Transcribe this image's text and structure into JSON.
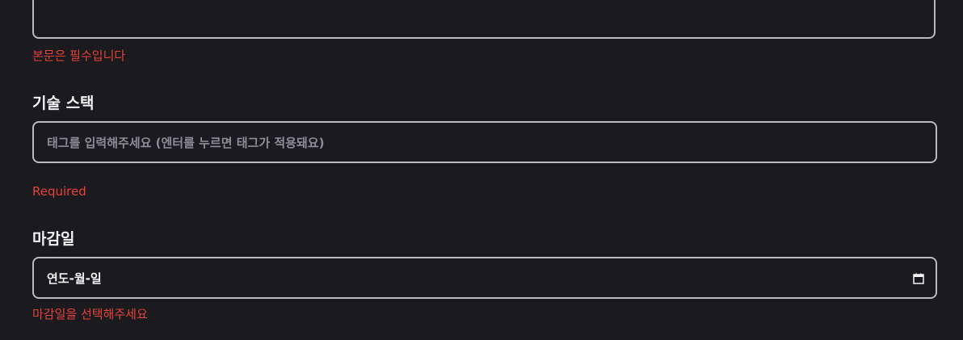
{
  "body_field": {
    "error": "본문은 필수입니다"
  },
  "tech_stack": {
    "label": "기술 스택",
    "placeholder": "태그를 입력해주세요 (엔터를 누르면 태그가 적용돼요)",
    "error": "Required"
  },
  "deadline": {
    "label": "마감일",
    "value": "연도-월-일",
    "icon": "calendar-icon",
    "error": "마감일을 선택해주세요"
  },
  "colors": {
    "background": "#1b1a1f",
    "border": "#b9b8c0",
    "error": "#e8413a",
    "label": "#f2f2f4",
    "placeholder": "#8e8d95"
  }
}
